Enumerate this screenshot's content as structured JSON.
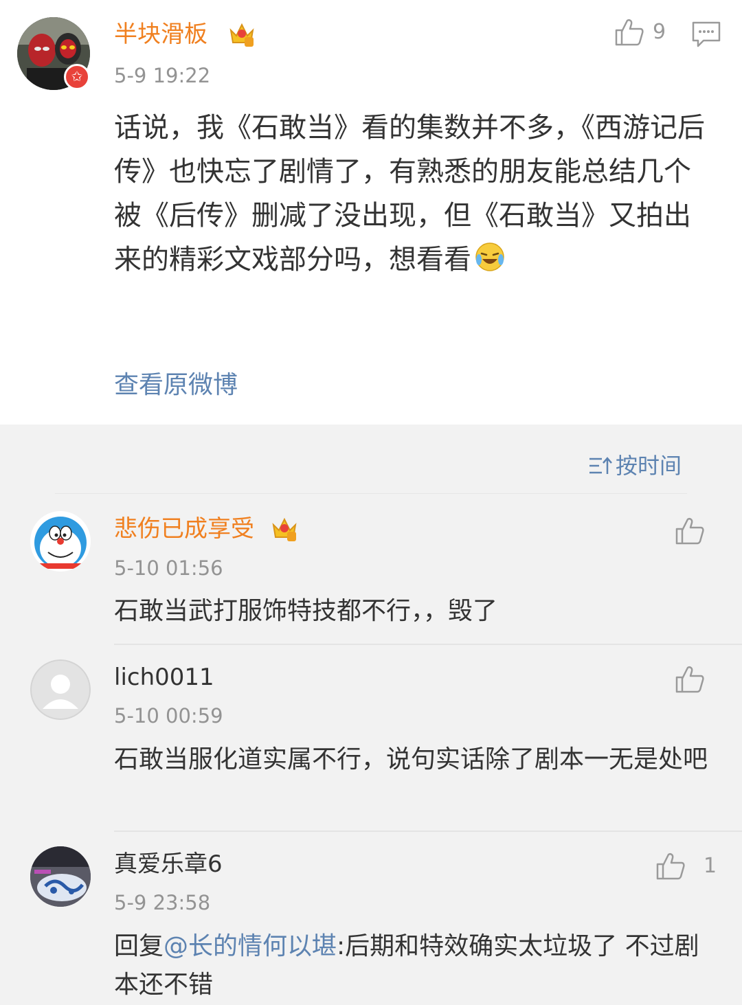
{
  "post": {
    "username": "半块滑板",
    "time": "5-9 19:22",
    "likes": "9",
    "text": "话说，我《石敢当》看的集数并不多，《西游记后传》也快忘了剧情了，有熟悉的朋友能总结几个被《后传》删减了没出现，但《石敢当》又拍出来的精彩文戏部分吗，想看看",
    "emoji": "laugh-cry-emoji",
    "view_original": "查看原微博"
  },
  "sort_label": "按时间",
  "comments": [
    {
      "username": "悲伤已成享受",
      "time": "5-10 01:56",
      "text": "石敢当武打服饰特技都不行，，毁了",
      "likes": ""
    },
    {
      "username": "lich0011",
      "time": "5-10 00:59",
      "text": "石敢当服化道实属不行，说句实话除了剧本一无是处吧",
      "likes": ""
    },
    {
      "username": "真爱乐章6",
      "time": "5-9 23:58",
      "reply_prefix": "回复",
      "mention": "@长的情何以堪",
      "text": ":后期和特效确实太垃圾了 不过剧本还不错",
      "likes": "1"
    }
  ],
  "colors": {
    "accent": "#f08020",
    "link": "#5d83b1",
    "meta": "#939393",
    "badge": "#e8423a"
  }
}
